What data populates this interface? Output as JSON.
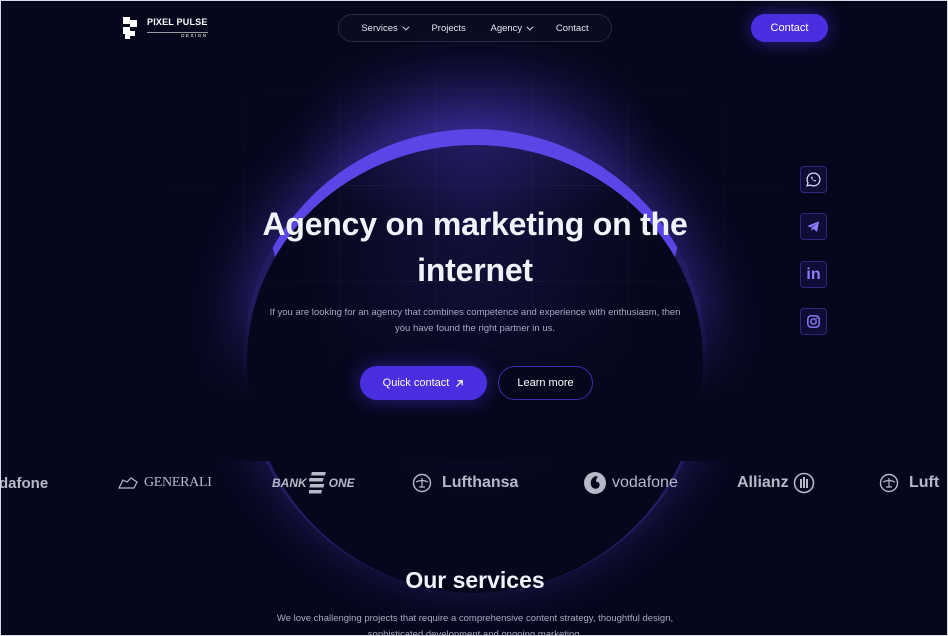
{
  "colors": {
    "background": "#06071c",
    "accent": "#4a2fe0",
    "arc": "#5a46e6",
    "muted_text": "#a9a9c2",
    "brand_logos": "#b8b8c9"
  },
  "header": {
    "logo": {
      "name": "PIXEL PULSE",
      "sub": "DESIGN",
      "icon": "pixel-logo-icon"
    },
    "nav": [
      {
        "label": "Services",
        "has_dropdown": true
      },
      {
        "label": "Projects",
        "has_dropdown": false
      },
      {
        "label": "Agency",
        "has_dropdown": true
      },
      {
        "label": "Contact",
        "has_dropdown": false
      }
    ],
    "contact_button": "Contact"
  },
  "hero": {
    "title": "Agency on marketing on the internet",
    "subtitle": "If you are looking for an agency that combines competence and experience with enthusiasm, then you have found the right partner in us.",
    "primary_button": "Quick contact",
    "primary_button_icon": "arrow-up-right-icon",
    "secondary_button": "Learn more"
  },
  "social": [
    {
      "name": "whatsapp",
      "icon": "whatsapp-icon"
    },
    {
      "name": "telegram",
      "icon": "telegram-icon"
    },
    {
      "name": "linkedin",
      "icon": "linkedin-icon",
      "text": "in"
    },
    {
      "name": "instagram",
      "icon": "instagram-icon"
    }
  ],
  "brands": [
    {
      "name": "dafone"
    },
    {
      "name": "GENERALI"
    },
    {
      "name": "BANK",
      "second": "ONE"
    },
    {
      "name": "Lufthansa"
    },
    {
      "name": "vodafone"
    },
    {
      "name": "Allianz"
    },
    {
      "name": "Luft"
    }
  ],
  "services": {
    "title": "Our services",
    "description": "We love challenging projects that require a comprehensive content strategy, thoughtful design, sophisticated development and ongoing marketing."
  }
}
